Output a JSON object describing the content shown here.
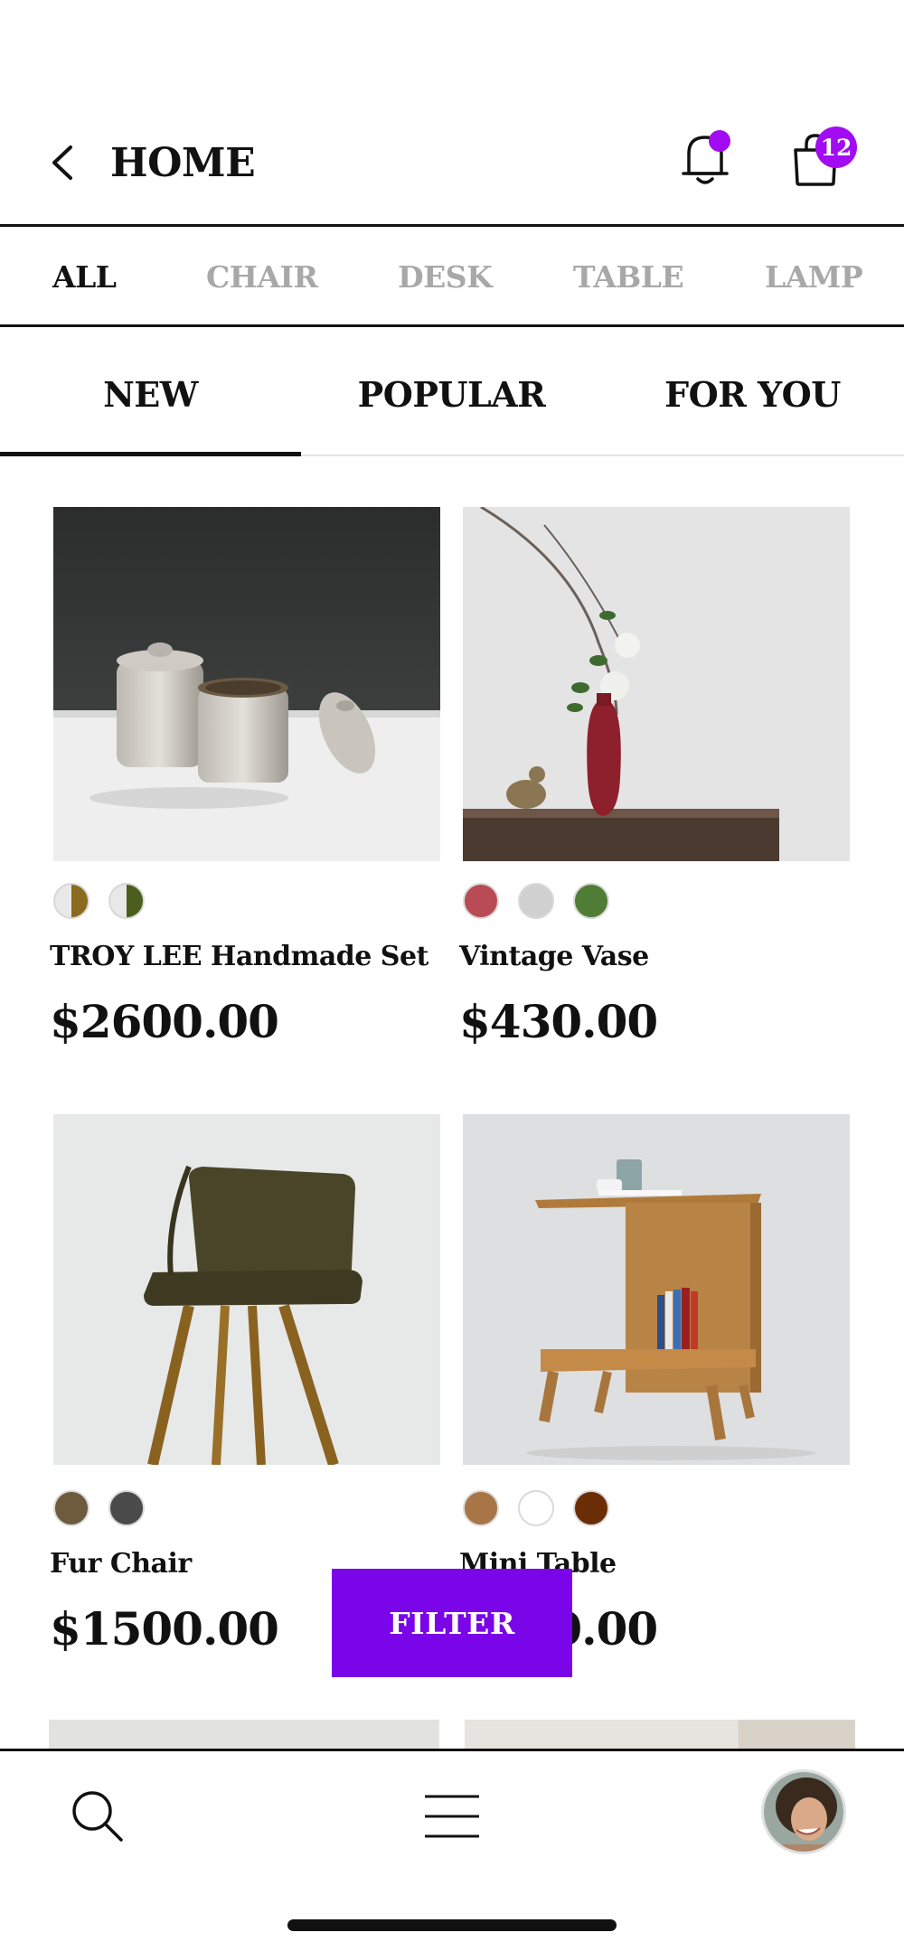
{
  "header": {
    "title": "HOME",
    "cart_count": "12"
  },
  "categories": [
    "ALL",
    "CHAIR",
    "DESK",
    "TABLE",
    "LAMP"
  ],
  "tabs": [
    "NEW",
    "POPULAR",
    "FOR YOU"
  ],
  "products": [
    {
      "name": "TROY LEE Handmade Set",
      "price": "$2600.00",
      "swatches": [
        "#8a6a1e",
        "#4b5e1c"
      ]
    },
    {
      "name": "Vintage Vase",
      "price": "$430.00",
      "swatches": [
        "#b94b55",
        "#d0d0d0",
        "#4f7d35"
      ]
    },
    {
      "name": "Fur Chair",
      "price": "$1500.00",
      "swatches": [
        "#6e5a3c",
        "#4a4a4a"
      ]
    },
    {
      "name": "Mini Table",
      "price": "$740.00",
      "swatches": [
        "#a87547",
        "#ffffff",
        "#6b2d06"
      ]
    }
  ],
  "filter_label": "FILTER",
  "colors": {
    "accent": "#7a05e8",
    "badge": "#a20cf2",
    "inactive_category": "#a8a8a8"
  },
  "icons": [
    "back-arrow-icon",
    "bell-icon",
    "shopping-bag-icon",
    "search-icon",
    "menu-icon"
  ]
}
